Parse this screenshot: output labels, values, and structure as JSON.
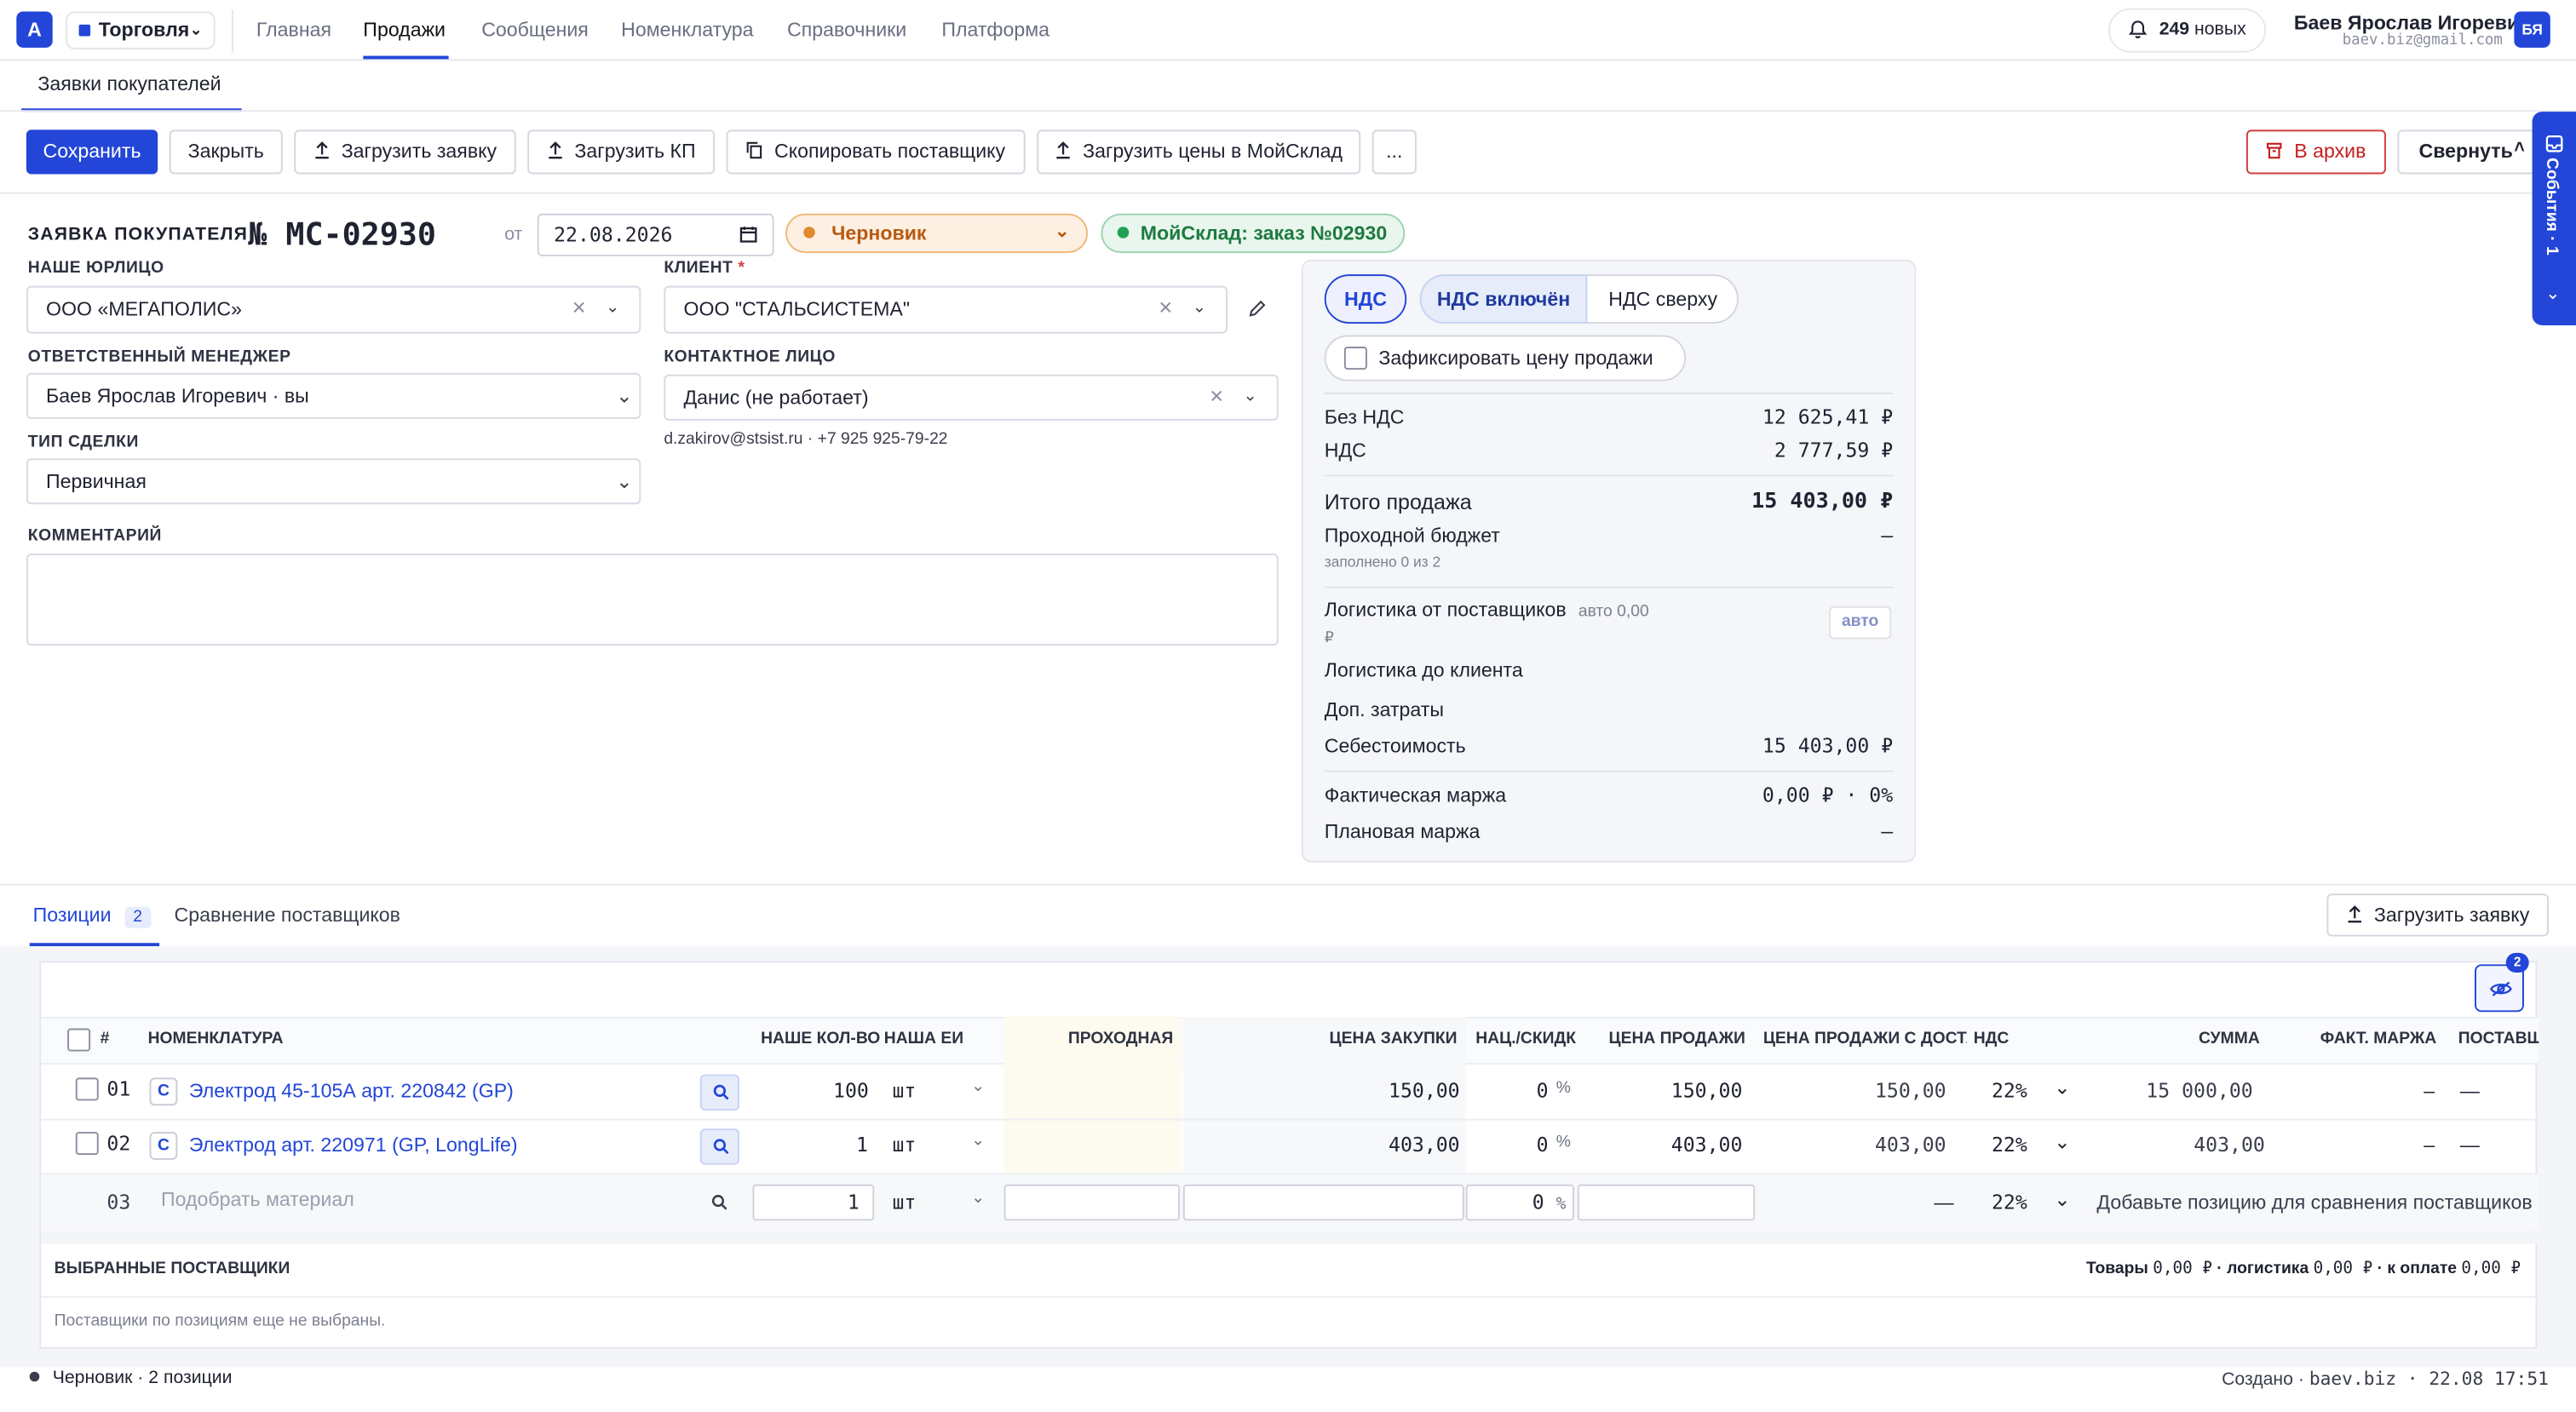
{
  "topbar": {
    "logo": "A",
    "workspace": "Торговля",
    "nav": [
      "Главная",
      "Продажи",
      "Сообщения",
      "Номенклатура",
      "Справочники",
      "Платформа"
    ],
    "notifications_count": "249",
    "notifications_label": "новых",
    "user_name": "Баев Ярослав Игоревич",
    "user_email": "baev.biz@gmail.com",
    "user_initials": "БЯ"
  },
  "page_tab": "Заявки покупателей",
  "toolbar": {
    "save": "Сохранить",
    "close": "Закрыть",
    "upload_request": "Загрузить заявку",
    "upload_kp": "Загрузить КП",
    "copy_supplier": "Скопировать поставщику",
    "upload_prices": "Загрузить цены в МойСклад",
    "more": "...",
    "archive": "В архив",
    "collapse": "Свернуть"
  },
  "events_tab": "События · 1",
  "document": {
    "title_label": "ЗАЯВКА ПОКУПАТЕЛЯ",
    "number": "№ МС-02930",
    "from_label": "от",
    "date": "22.08.2026",
    "status": "Черновик",
    "moysklad": "МойСклад: заказ №02930"
  },
  "form": {
    "legal_label": "НАШЕ ЮРЛИЦО",
    "legal_value": "ООО «МЕГАПОЛИС»",
    "client_label": "КЛИЕНТ",
    "client_req": "*",
    "client_value": "ООО \"СТАЛЬСИСТЕМА\"",
    "manager_label": "ОТВЕТСТВЕННЫЙ МЕНЕДЖЕР",
    "manager_value": "Баев Ярослав Игоревич · вы",
    "contact_label": "КОНТАКТНОЕ ЛИЦО",
    "contact_value": "Данис (не работает)",
    "contact_info": "d.zakirov@stsist.ru · +7 925 925-79-22",
    "deal_label": "ТИП СДЕЛКИ",
    "deal_value": "Первичная",
    "comment_label": "КОММЕНТАРИЙ",
    "comment_value": ""
  },
  "panel": {
    "vat_tabs": [
      "НДС",
      "НДС включён",
      "НДС сверху"
    ],
    "fix_price": "Зафиксировать цену продажи",
    "without_vat_label": "Без НДС",
    "without_vat": "12 625,41 ₽",
    "vat_label": "НДС",
    "vat": "2 777,59 ₽",
    "total_label": "Итого продажа",
    "total": "15 403,00 ₽",
    "budget_label": "Проходной бюджет",
    "budget": "–",
    "budget_sub": "заполнено 0 из 2",
    "log_sup_label": "Логистика от поставщиков",
    "log_sup_auto": "авто 0,00",
    "log_sup_cur": "₽",
    "auto_btn": "авто",
    "log_client_label": "Логистика до клиента",
    "extra_label": "Доп. затраты",
    "cost_label": "Себестоимость",
    "cost": "15 403,00 ₽",
    "fact_margin_label": "Фактическая маржа",
    "fact_margin": "0,00 ₽ · 0%",
    "plan_margin_label": "Плановая маржа",
    "plan_margin": "–"
  },
  "tabs": {
    "positions": "Позиции",
    "positions_count": "2",
    "compare": "Сравнение поставщиков",
    "upload": "Загрузить заявку"
  },
  "table": {
    "eye_badge": "2",
    "headers": [
      "#",
      "НОМЕНКЛАТУРА",
      "НАШЕ КОЛ-ВО",
      "НАША ЕИ",
      "ПРОХОДНАЯ",
      "ЦЕНА ЗАКУПКИ",
      "НАЦ./СКИДК",
      "ЦЕНА ПРОДАЖИ",
      "ЦЕНА ПРОДАЖИ С ДОСТА",
      "НДС",
      "СУММА",
      "ФАКТ. МАРЖА",
      "ПОСТАВЩ"
    ],
    "rows": [
      {
        "num": "01",
        "type": "С",
        "name": "Электрод 45-105А арт. 220842 (GP)",
        "qty": "100",
        "unit": "шт",
        "purchase": "150,00",
        "markup": "0",
        "pct": "%",
        "sale": "150,00",
        "sale_del": "150,00",
        "vat": "22%",
        "sum": "15 000,00",
        "margin": "–",
        "supplier": "—"
      },
      {
        "num": "02",
        "type": "С",
        "name": "Электрод арт. 220971 (GP, LongLife)",
        "qty": "1",
        "unit": "шт",
        "purchase": "403,00",
        "markup": "0",
        "pct": "%",
        "sale": "403,00",
        "sale_del": "403,00",
        "vat": "22%",
        "sum": "403,00",
        "margin": "–",
        "supplier": "—"
      }
    ],
    "new_row": {
      "num": "03",
      "placeholder": "Подобрать материал",
      "qty": "1",
      "unit": "шт",
      "markup": "0",
      "pct": "%",
      "sale_del": "—",
      "vat": "22%",
      "hint": "Добавьте позицию для сравнения поставщиков"
    },
    "suppliers_title": "ВЫБРАННЫЕ ПОСТАВЩИКИ",
    "sum_goods_label": "Товары",
    "sum_goods": "0,00 ₽",
    "sum_log_label": "· логистика",
    "sum_log": "0,00 ₽",
    "sum_pay_label": "· к оплате",
    "sum_pay": "0,00 ₽",
    "suppliers_empty": "Поставщики по позициям еще не выбраны."
  },
  "footer": {
    "status": "Черновик · 2 позиции",
    "created_label": "Создано ·",
    "created_by": "baev.biz · 22.08 17:51"
  }
}
